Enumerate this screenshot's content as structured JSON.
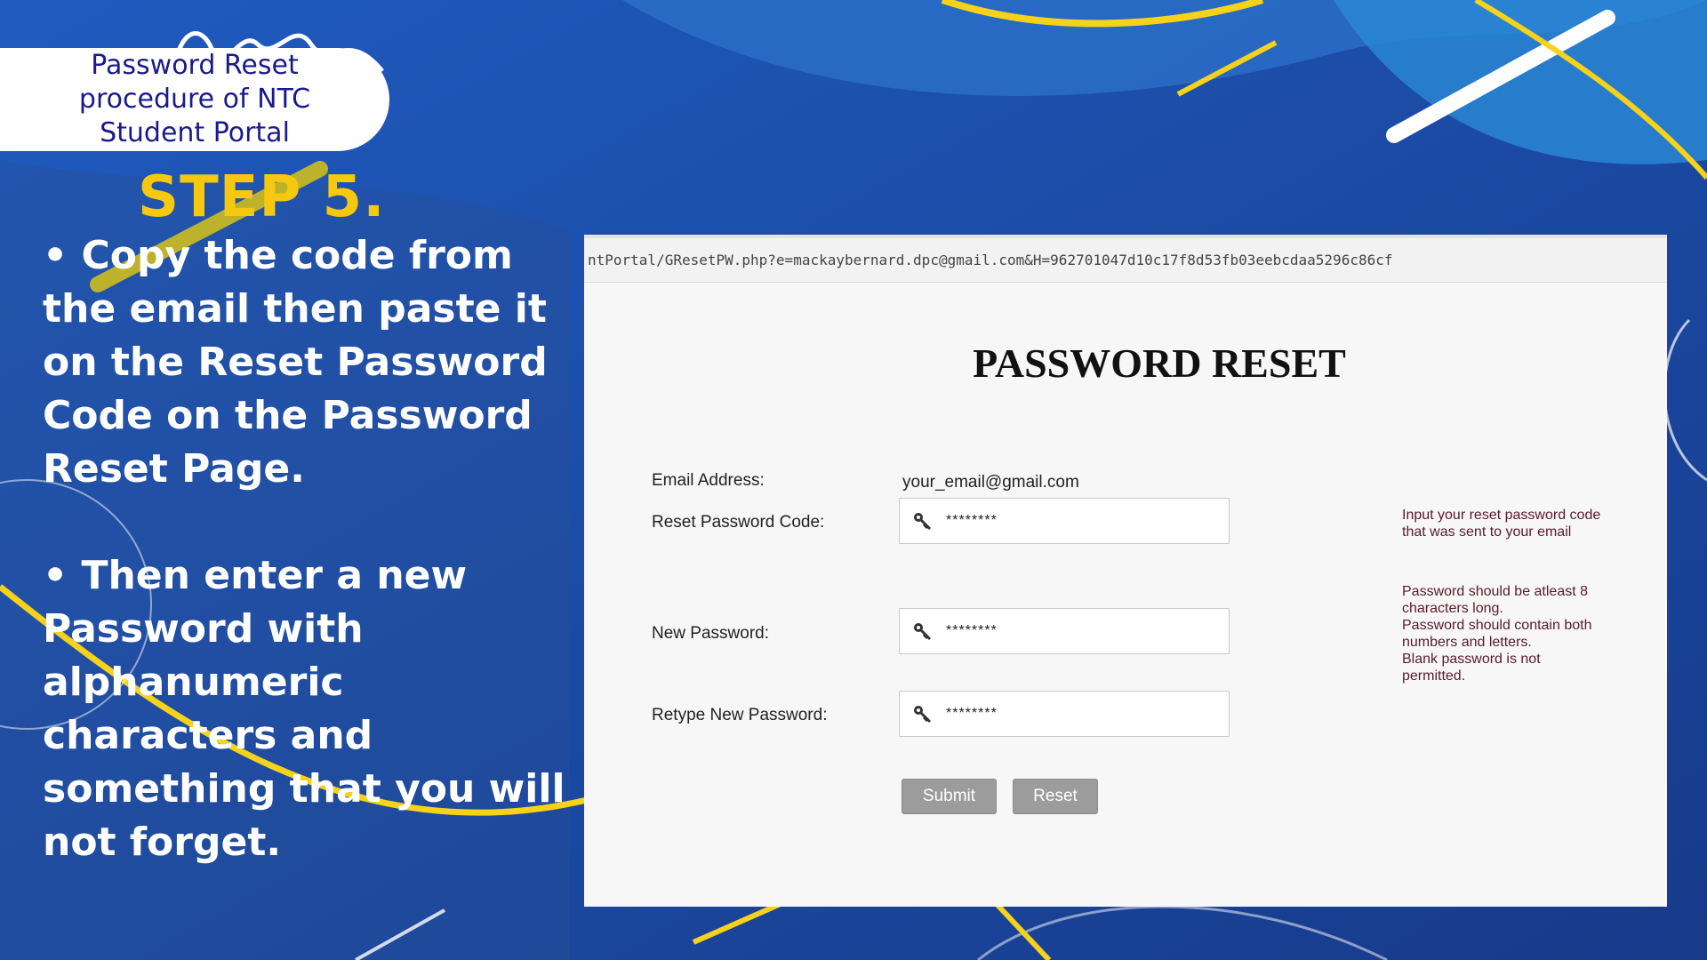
{
  "slide": {
    "badge_title": "Password Reset\nprocedure of NTC\nStudent Portal",
    "step_label": "STEP 5.",
    "instruction_1": "• Copy the code from the email then paste it on the Reset Password Code on the Password Reset Page.",
    "instruction_2": "• Then enter a new Password with alphanumeric characters and something that you will not forget.",
    "colors": {
      "background": "#1e4aa0",
      "accent_yellow": "#f6c90e",
      "badge_text": "#1a1b8a"
    }
  },
  "browser": {
    "url": "ntPortal/GResetPW.php?e=mackaybernard.dpc@gmail.com&H=962701047d10c17f8d53fb03eebcdaa5296c86cf"
  },
  "form": {
    "title": "PASSWORD RESET",
    "email_label": "Email Address:",
    "email_value": "your_email@gmail.com",
    "code_label": "Reset Password Code:",
    "code_value": "********",
    "new_password_label": "New Password:",
    "new_password_value": "********",
    "retype_label": "Retype New Password:",
    "retype_value": "********",
    "code_hint": "Input your reset password code\nthat was sent to your email",
    "password_hint": "Password should be atleast 8\ncharacters long.\nPassword should contain both\nnumbers and letters.\nBlank password is not\npermitted.",
    "submit_label": "Submit",
    "reset_label": "Reset",
    "field_icon": "key-icon"
  }
}
